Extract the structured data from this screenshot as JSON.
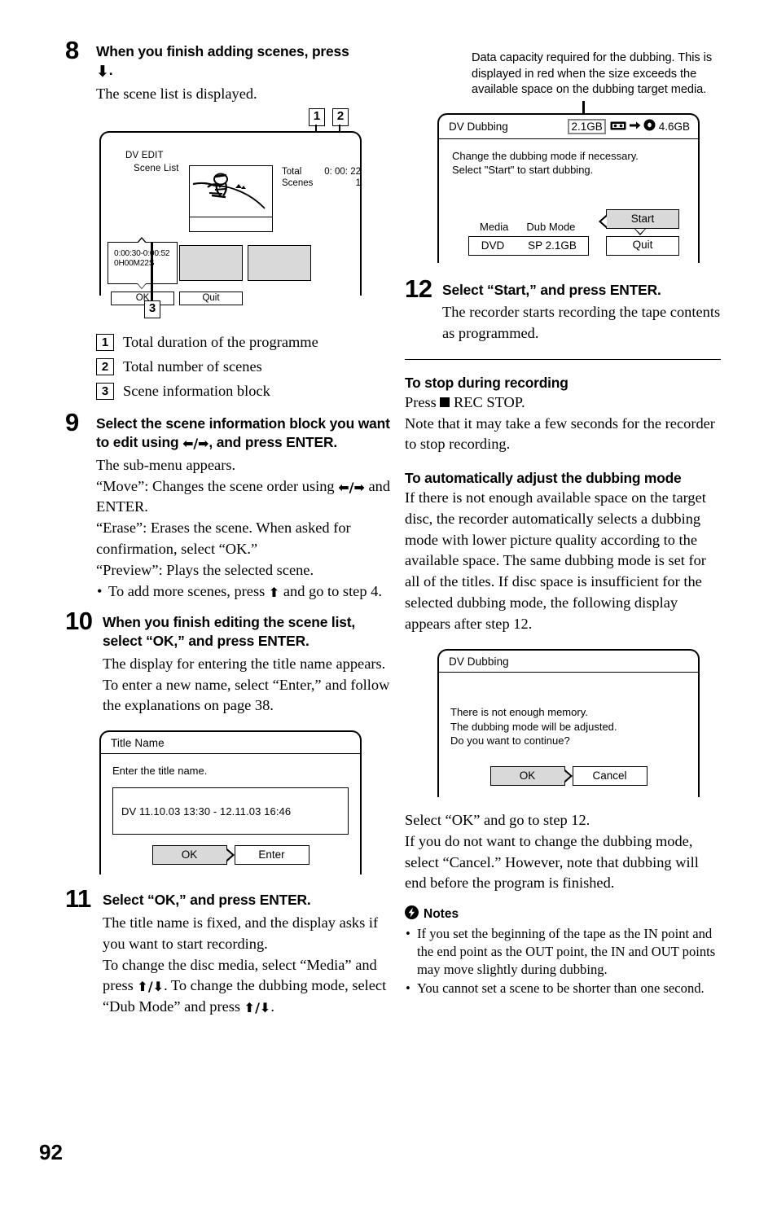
{
  "page": {
    "number": "92"
  },
  "left_column": {
    "step8": {
      "number": "8",
      "heading_part1": "When you finish adding scenes, press",
      "heading_arrow": "down-arrow",
      "heading_part2": ".",
      "body": "The scene list is displayed."
    },
    "scene_list_figure": {
      "title": "DV EDIT",
      "subtitle": "Scene List",
      "total_label": "Total",
      "total_value": "0: 00: 22",
      "scenes_label": "Scenes",
      "scenes_value": "1",
      "scene_block_time": "0:00:30-0:00:52",
      "scene_block_duration": "0H00M22S",
      "ok_label": "OK",
      "quit_label": "Quit",
      "tag1": "1",
      "tag2": "2",
      "tag3": "3"
    },
    "callouts": [
      {
        "num": "1",
        "label": "Total duration of the programme"
      },
      {
        "num": "2",
        "label": "Total number of scenes"
      },
      {
        "num": "3",
        "label": "Scene information block"
      }
    ],
    "step9": {
      "number": "9",
      "heading_a": "Select the scene information block you want to edit using ",
      "heading_b": ", and press ENTER.",
      "line1": "The sub-menu appears.",
      "line2a": "“Move”: Changes the scene order using ",
      "line2b": " and ENTER.",
      "line3": "“Erase”: Erases the scene. When asked for confirmation, select “OK.”",
      "line4": "“Preview”: Plays the selected scene.",
      "bullet_a": "To add more scenes, press ",
      "bullet_b": " and go to step 4."
    },
    "step10": {
      "number": "10",
      "heading": "When you finish editing the scene list, select “OK,” and press ENTER.",
      "body": "The display for entering the title name appears. To enter a new name, select “Enter,” and follow the explanations on page 38."
    },
    "title_name_dialog": {
      "title": "Title Name",
      "prompt": "Enter the title name.",
      "value": "DV 11.10.03 13:30 - 12.11.03 16:46",
      "ok_label": "OK",
      "enter_label": "Enter"
    },
    "step11": {
      "number": "11",
      "heading": "Select “OK,” and press ENTER.",
      "line1": "The title name is fixed, and the display asks if you want to start recording.",
      "line2a": "To change the disc media, select “Media” and press ",
      "line2b": ". To change the dubbing mode, select “Dub Mode” and press ",
      "line2c": "."
    }
  },
  "right_column": {
    "capacity_note": "Data capacity required for the dubbing. This is displayed in red when the size exceeds the available space on the dubbing target media.",
    "dub_dialog": {
      "title": "DV Dubbing",
      "required_size": "2.1GB",
      "available_size": "4.6GB",
      "tape_icon": "tape-icon",
      "arrow_icon": "right-arrow-icon",
      "disc_icon": "disc-icon",
      "body_line1": "Change the dubbing mode if necessary.",
      "body_line2": "Select \"Start\" to start dubbing.",
      "media_label": "Media",
      "dub_mode_label": "Dub Mode",
      "media_value": "DVD",
      "dub_mode_value": "SP 2.1GB",
      "start_label": "Start",
      "quit_label": "Quit"
    },
    "step12": {
      "number": "12",
      "heading": "Select “Start,” and press ENTER.",
      "body": "The recorder starts recording the tape contents as programmed."
    },
    "stop_section": {
      "heading": "To stop during recording",
      "line1a": "Press ",
      "line1b": " REC STOP.",
      "line2": "Note that it may take a few seconds for the recorder to stop recording."
    },
    "auto_adjust_section": {
      "heading": "To automatically adjust the dubbing mode",
      "body": "If there is not enough available space on the target disc, the recorder automatically selects a dubbing mode with lower picture quality according to the available space. The same dubbing mode is set for all of the titles. If disc space is insufficient for the selected dubbing mode, the following display appears after step 12."
    },
    "memory_dialog": {
      "title": "DV Dubbing",
      "line1": "There is not enough memory.",
      "line2": "The dubbing mode will be adjusted.",
      "line3": "Do you want to continue?",
      "ok_label": "OK",
      "cancel_label": "Cancel"
    },
    "after_dialog_text": "Select “OK” and go to step 12.\nIf you do not want to change the dubbing mode, select “Cancel.” However, note that dubbing will end before the program is finished.",
    "notes": {
      "icon": "notes-bolt-icon",
      "heading": "Notes",
      "items": [
        "If you set the beginning of the tape as the IN point and the end point as the OUT point, the IN and OUT points may move slightly during dubbing.",
        "You cannot set a scene to be shorter than one second."
      ]
    }
  }
}
